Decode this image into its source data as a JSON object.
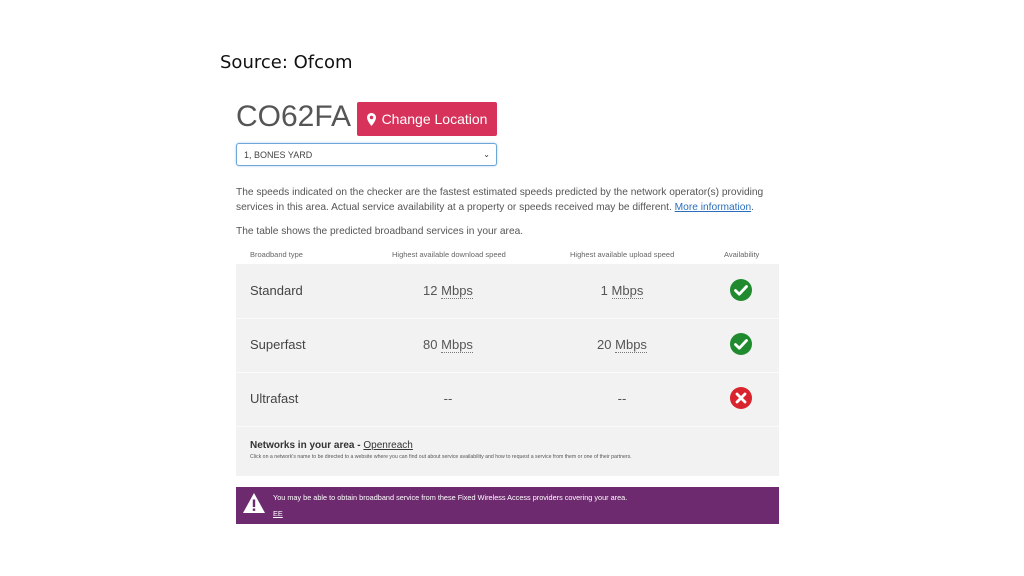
{
  "source_caption": "Source: Ofcom",
  "postcode": "CO62FA",
  "change_location": {
    "label": "Change Location",
    "icon": "map-marker-icon"
  },
  "address_select": {
    "value": "1, BONES YARD"
  },
  "intro": {
    "text": "The speeds indicated on the checker are the fastest estimated speeds predicted by the network operator(s) providing services in this area. Actual service availability at a property or speeds received may be different.",
    "link": "More information",
    "end": "."
  },
  "table_intro": "The table shows the predicted broadband services in your area.",
  "table": {
    "headers": {
      "type": "Broadband type",
      "download": "Highest available download speed",
      "upload": "Highest available upload speed",
      "availability": "Availability"
    },
    "rows": [
      {
        "type": "Standard",
        "download_value": "12",
        "download_unit": "Mbps",
        "upload_value": "1",
        "upload_unit": "Mbps",
        "available": true
      },
      {
        "type": "Superfast",
        "download_value": "80",
        "download_unit": "Mbps",
        "upload_value": "20",
        "upload_unit": "Mbps",
        "available": true
      },
      {
        "type": "Ultrafast",
        "download_value": "--",
        "download_unit": "",
        "upload_value": "--",
        "upload_unit": "",
        "available": false
      }
    ]
  },
  "networks": {
    "label": "Networks in your area - ",
    "provider": "Openreach",
    "note": "Click on a network's name to be directed to a website where you can find out about service availability and how to request a service from them or one of their partners."
  },
  "fwa_banner": {
    "message": "You may be able to obtain broadband service from these Fixed Wireless Access providers covering your area.",
    "provider": "EE",
    "color": "#6d2a6f"
  },
  "colors": {
    "accent": "#d6325a",
    "available": "#1f8a2e",
    "unavailable": "#d9232d"
  }
}
